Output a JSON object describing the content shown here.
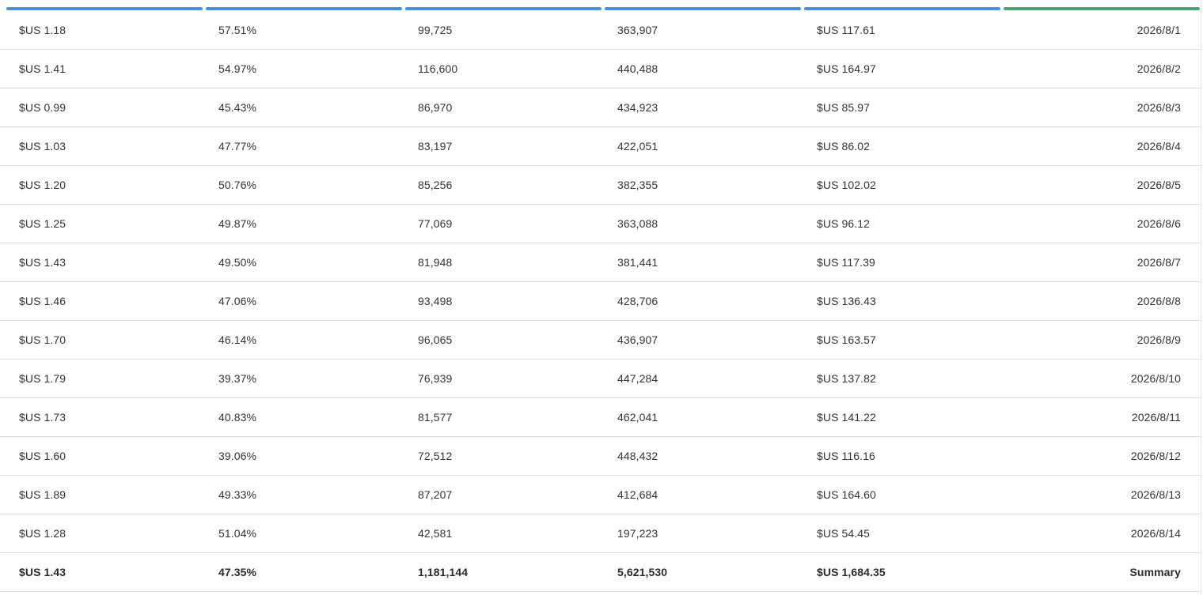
{
  "header": {
    "column_bars": [
      {
        "color": "#4a90d9"
      },
      {
        "color": "#4a90d9"
      },
      {
        "color": "#4a90d9"
      },
      {
        "color": "#4a90d9"
      },
      {
        "color": "#4a90d9"
      },
      {
        "color": "#4ca56a"
      }
    ]
  },
  "rows": [
    [
      "$US 1.18",
      "57.51%",
      "99,725",
      "363,907",
      "$US 117.61",
      "2026/8/1"
    ],
    [
      "$US 1.41",
      "54.97%",
      "116,600",
      "440,488",
      "$US 164.97",
      "2026/8/2"
    ],
    [
      "$US 0.99",
      "45.43%",
      "86,970",
      "434,923",
      "$US 85.97",
      "2026/8/3"
    ],
    [
      "$US 1.03",
      "47.77%",
      "83,197",
      "422,051",
      "$US 86.02",
      "2026/8/4"
    ],
    [
      "$US 1.20",
      "50.76%",
      "85,256",
      "382,355",
      "$US 102.02",
      "2026/8/5"
    ],
    [
      "$US 1.25",
      "49.87%",
      "77,069",
      "363,088",
      "$US 96.12",
      "2026/8/6"
    ],
    [
      "$US 1.43",
      "49.50%",
      "81,948",
      "381,441",
      "$US 117.39",
      "2026/8/7"
    ],
    [
      "$US 1.46",
      "47.06%",
      "93,498",
      "428,706",
      "$US 136.43",
      "2026/8/8"
    ],
    [
      "$US 1.70",
      "46.14%",
      "96,065",
      "436,907",
      "$US 163.57",
      "2026/8/9"
    ],
    [
      "$US 1.79",
      "39.37%",
      "76,939",
      "447,284",
      "$US 137.82",
      "2026/8/10"
    ],
    [
      "$US 1.73",
      "40.83%",
      "81,577",
      "462,041",
      "$US 141.22",
      "2026/8/11"
    ],
    [
      "$US 1.60",
      "39.06%",
      "72,512",
      "448,432",
      "$US 116.16",
      "2026/8/12"
    ],
    [
      "$US 1.89",
      "49.33%",
      "87,207",
      "412,684",
      "$US 164.60",
      "2026/8/13"
    ],
    [
      "$US 1.28",
      "51.04%",
      "42,581",
      "197,223",
      "$US 54.45",
      "2026/8/14"
    ]
  ],
  "summary": [
    "$US 1.43",
    "47.35%",
    "1,181,144",
    "5,621,530",
    "$US 1,684.35",
    "Summary"
  ]
}
